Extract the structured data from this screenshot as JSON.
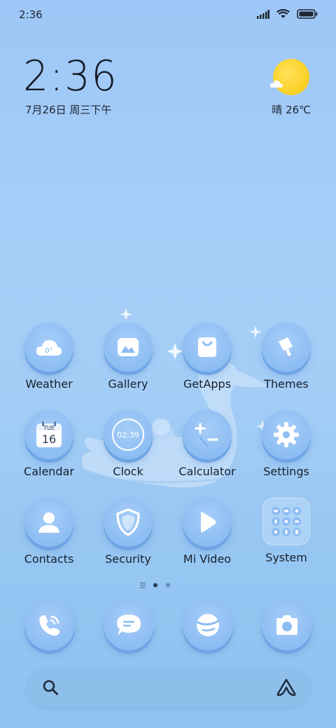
{
  "status_bar": {
    "time": "2:36"
  },
  "clock_widget": {
    "time": "2:36",
    "date": "7月26日 周三下午"
  },
  "weather_widget": {
    "condition": "晴",
    "temperature": "26℃",
    "icon": "sun-cloud-icon"
  },
  "apps": [
    {
      "label": "Weather",
      "icon": "weather-cloud-icon"
    },
    {
      "label": "Gallery",
      "icon": "gallery-icon"
    },
    {
      "label": "GetApps",
      "icon": "shopping-bag-icon"
    },
    {
      "label": "Themes",
      "icon": "paintbrush-icon"
    },
    {
      "label": "Calendar",
      "icon": "calendar-icon",
      "cal_day": "TUE",
      "cal_date": "16"
    },
    {
      "label": "Clock",
      "icon": "clock-icon",
      "clock_text": "02:39"
    },
    {
      "label": "Calculator",
      "icon": "calculator-icon"
    },
    {
      "label": "Settings",
      "icon": "gear-icon"
    },
    {
      "label": "Contacts",
      "icon": "person-icon"
    },
    {
      "label": "Security",
      "icon": "shield-icon"
    },
    {
      "label": "Mi Video",
      "icon": "play-icon"
    },
    {
      "label": "System",
      "icon": "folder-icon"
    }
  ],
  "weather_icon_text": "0°",
  "dock": [
    {
      "icon": "phone-icon"
    },
    {
      "icon": "message-icon"
    },
    {
      "icon": "browser-icon"
    },
    {
      "icon": "camera-icon"
    }
  ],
  "page_indicator": {
    "pages": 2,
    "current": 1
  },
  "colors": {
    "accent": "#8dbdf3",
    "sun": "#f7c70c"
  }
}
